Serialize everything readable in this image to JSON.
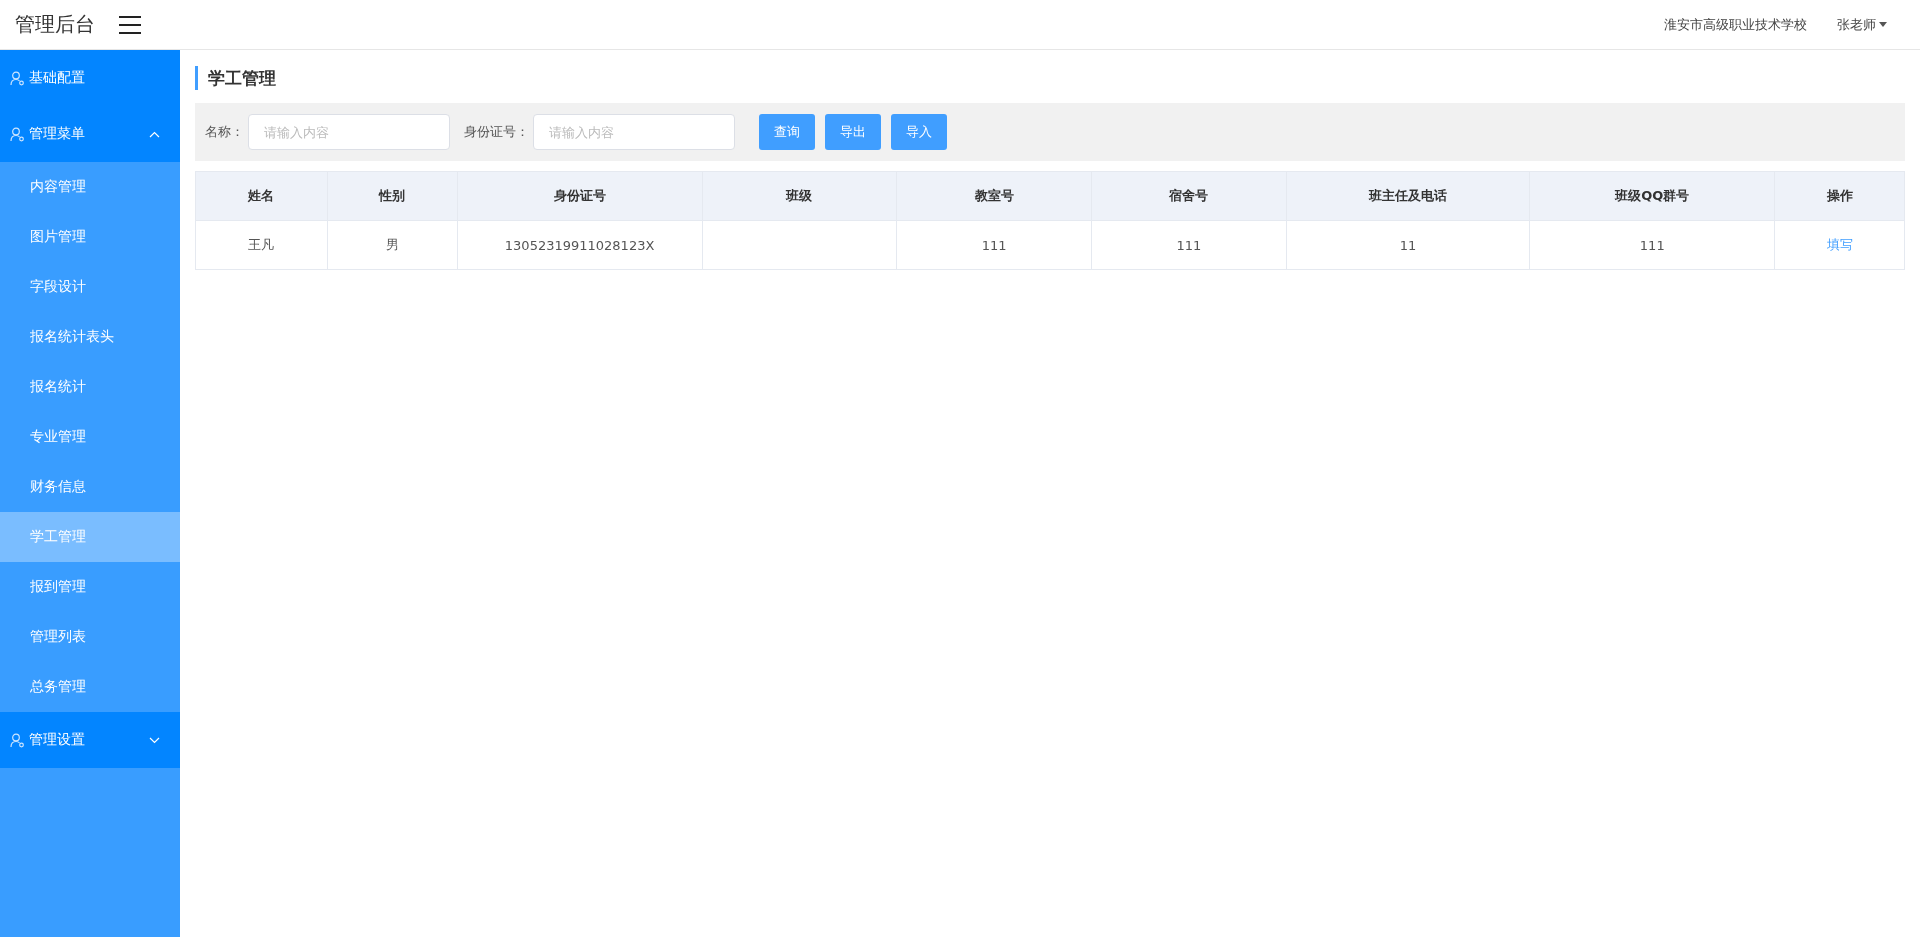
{
  "header": {
    "brand": "管理后台",
    "school": "淮安市高级职业技术学校",
    "user": "张老师"
  },
  "sidebar": {
    "groups": [
      {
        "label": "基础配置",
        "kind": "link"
      },
      {
        "label": "管理菜单",
        "kind": "menu",
        "expanded": true,
        "items": [
          {
            "label": "内容管理",
            "selected": false
          },
          {
            "label": "图片管理",
            "selected": false
          },
          {
            "label": "字段设计",
            "selected": false
          },
          {
            "label": "报名统计表头",
            "selected": false
          },
          {
            "label": "报名统计",
            "selected": false
          },
          {
            "label": "专业管理",
            "selected": false
          },
          {
            "label": "财务信息",
            "selected": false
          },
          {
            "label": "学工管理",
            "selected": true
          },
          {
            "label": "报到管理",
            "selected": false
          },
          {
            "label": "管理列表",
            "selected": false
          },
          {
            "label": "总务管理",
            "selected": false
          }
        ]
      },
      {
        "label": "管理设置",
        "kind": "menu",
        "expanded": false
      }
    ]
  },
  "page": {
    "title": "学工管理",
    "filters": [
      {
        "label": "名称：",
        "placeholder": "请输入内容"
      },
      {
        "label": "身份证号：",
        "placeholder": "请输入内容"
      }
    ],
    "buttons": [
      "查询",
      "导出",
      "导入"
    ],
    "table": {
      "columns": [
        "姓名",
        "性别",
        "身份证号",
        "班级",
        "教室号",
        "宿舍号",
        "班主任及电话",
        "班级QQ群号",
        "操作"
      ],
      "rows": [
        {
          "cells": [
            "王凡",
            "男",
            "13052319911028123X",
            "",
            "111",
            "111",
            "11",
            "111"
          ],
          "action": "填写"
        }
      ]
    }
  }
}
